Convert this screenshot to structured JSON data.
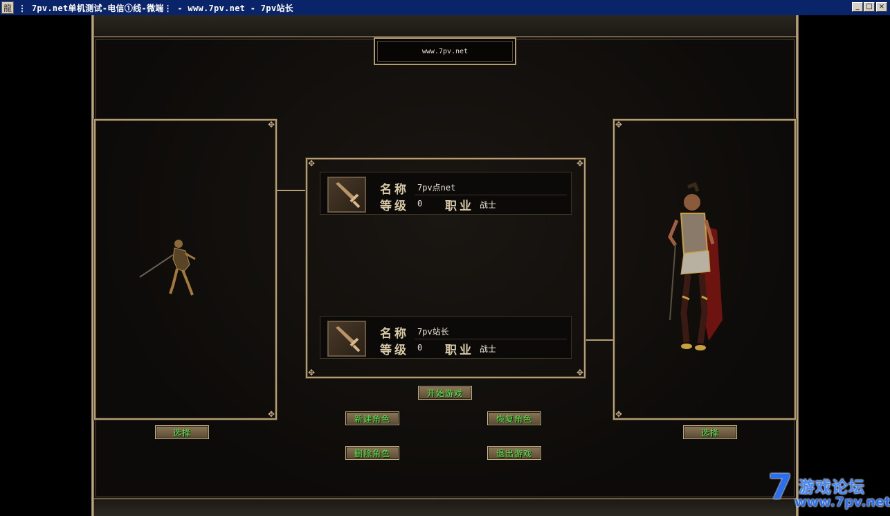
{
  "window": {
    "icon_glyph": "龍",
    "title": "⋮ 7pv.net单机测试-电信①线-微端⋮ - www.7pv.net - 7pv站长",
    "minimize": "_",
    "maximize": "□",
    "close": "×"
  },
  "banner": {
    "url": "www.7pv.net"
  },
  "characters": [
    {
      "name_label": "名称",
      "name": "7pv点net",
      "level_label": "等级",
      "level": "0",
      "job_label": "职业",
      "job": "战士"
    },
    {
      "name_label": "名称",
      "name": "7pv站长",
      "level_label": "等级",
      "level": "0",
      "job_label": "职业",
      "job": "战士"
    }
  ],
  "buttons": {
    "start_game": "开始游戏",
    "new_character": "新建角色",
    "restore_character": "恢复角色",
    "delete_character": "删除角色",
    "exit_game": "退出游戏",
    "select_left": "选择",
    "select_right": "选择"
  },
  "watermark": {
    "seven": "7",
    "site_name": "游戏论坛",
    "url": "www.7pv.net"
  },
  "colors": {
    "frame_gold": "#b49c73",
    "button_text": "#5ee050",
    "title_bar": "#0a246a",
    "watermark_blue": "#2a6ff0"
  },
  "icons": {
    "slot_icon": "sword-icon"
  }
}
